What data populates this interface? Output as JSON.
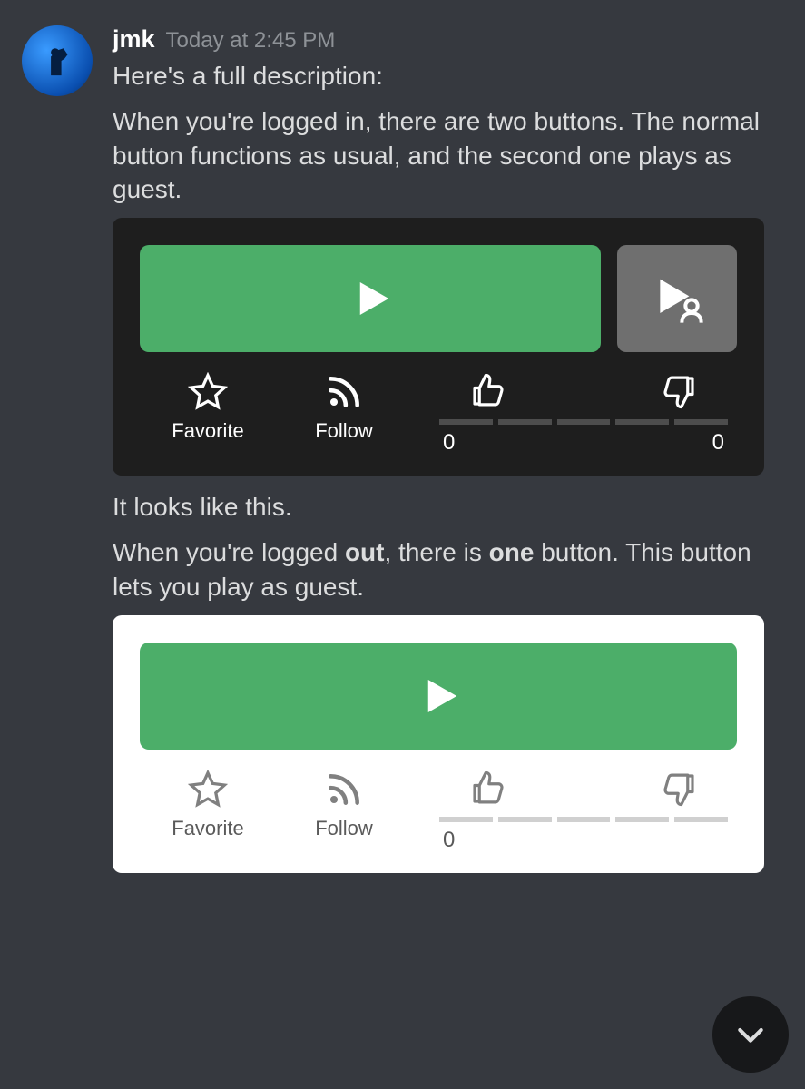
{
  "message": {
    "username": "jmk",
    "timestamp": "Today at 2:45 PM",
    "line1": "Here's a full description:",
    "line2": "When you're logged in, there are two buttons. The normal button functions as usual, and the second one plays as guest.",
    "line3": "It looks like this.",
    "line4_pre": "When you're logged ",
    "line4_bold1": "out",
    "line4_mid": ", there is ",
    "line4_bold2": "one",
    "line4_post": " button. This button lets you play as guest."
  },
  "card1": {
    "favorite_label": "Favorite",
    "follow_label": "Follow",
    "likes": "0",
    "dislikes": "0"
  },
  "card2": {
    "favorite_label": "Favorite",
    "follow_label": "Follow",
    "likes": "0"
  }
}
